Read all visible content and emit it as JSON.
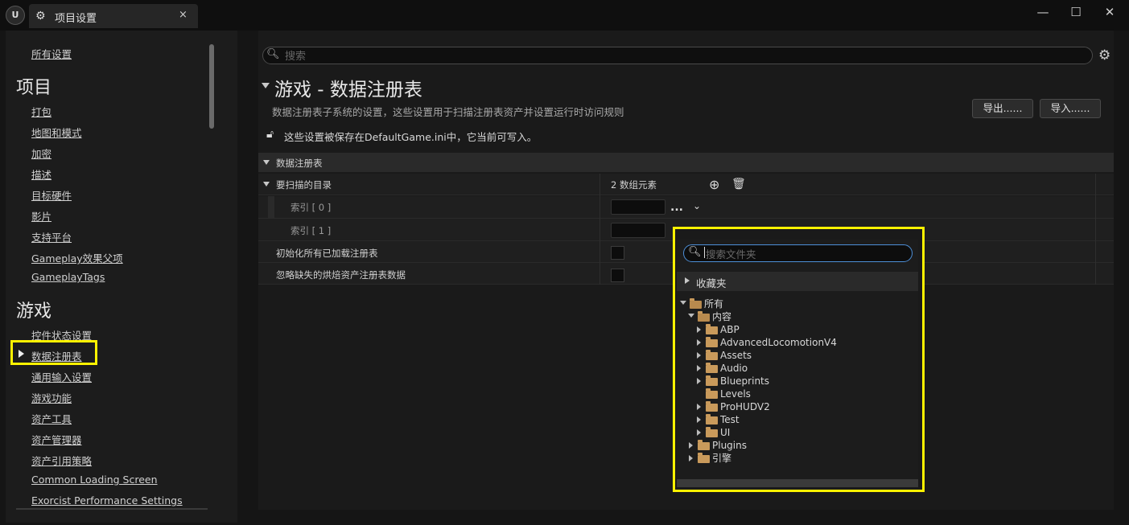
{
  "window": {
    "tab_title": "项目设置",
    "tab_close": "×",
    "minimize": "—",
    "maximize": "☐",
    "close": "✕"
  },
  "sidebar": {
    "all_settings": "所有设置",
    "section_project": "项目",
    "project_items": [
      "打包",
      "地图和模式",
      "加密",
      "描述",
      "目标硬件",
      "影片",
      "支持平台",
      "Gameplay效果父项",
      "GameplayTags"
    ],
    "section_game": "游戏",
    "game_items": [
      "控件状态设置",
      "数据注册表",
      "通用输入设置",
      "游戏功能",
      "资产工具",
      "资产管理器",
      "资产引用策略",
      "Common Loading Screen",
      "Exorcist Performance Settings"
    ],
    "selected": "数据注册表"
  },
  "search": {
    "placeholder": "搜索"
  },
  "header": {
    "title": "游戏 - 数据注册表",
    "description": "数据注册表子系统的设置，这些设置用于扫描注册表资产并设置运行时访问规则",
    "export_label": "导出......",
    "import_label": "导入......",
    "save_note": "这些设置被保存在DefaultGame.ini中，它当前可写入。"
  },
  "properties": {
    "category": "数据注册表",
    "scan_dirs_label": "要扫描的目录",
    "scan_dirs_count": "2 数组元素",
    "index0": "索引 [ 0 ]",
    "index1": "索引 [ 1 ]",
    "init_all_label": "初始化所有已加载注册表",
    "ignore_missing_label": "忽略缺失的烘焙资产注册表数据",
    "ellipsis": "..."
  },
  "folder_picker": {
    "search_placeholder": "搜索文件夹",
    "favorites": "收藏夹",
    "tree": {
      "all": "所有",
      "content": "内容",
      "children": [
        "ABP",
        "AdvancedLocomotionV4",
        "Assets",
        "Audio",
        "Blueprints",
        "Levels",
        "ProHUDV2",
        "Test",
        "UI"
      ],
      "plugins": "Plugins",
      "engine": "引擎"
    }
  },
  "colors": {
    "highlight": "#fff200",
    "folder": "#c99a5b",
    "focus": "#4d8fd8"
  }
}
